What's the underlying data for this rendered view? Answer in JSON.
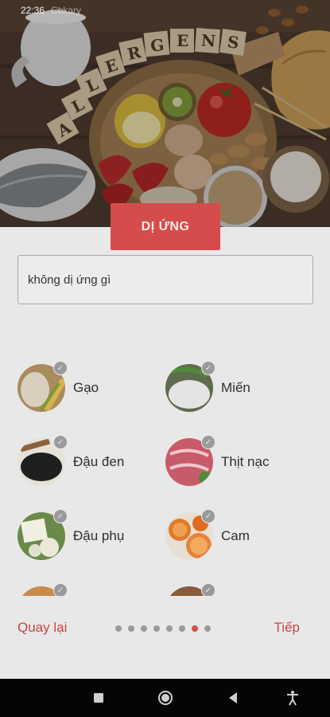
{
  "status_bar": {
    "time": "22:36",
    "carrier": "Cbkary"
  },
  "hero": {
    "sign_text": "ALLERGENS"
  },
  "title_button": "DỊ ỨNG",
  "input": {
    "value": "không dị ứng gì"
  },
  "foods": [
    {
      "label": "Gạo",
      "icon": "rice-icon"
    },
    {
      "label": "Miến",
      "icon": "vermicelli-icon"
    },
    {
      "label": "Đậu đen",
      "icon": "black-bean-icon"
    },
    {
      "label": "Thịt nạc",
      "icon": "lean-meat-icon"
    },
    {
      "label": "Đậu phụ",
      "icon": "tofu-icon"
    },
    {
      "label": "Cam",
      "icon": "orange-icon"
    }
  ],
  "nav": {
    "back_label": "Quay lại",
    "next_label": "Tiếp",
    "page_count": 8,
    "active_page": 7
  },
  "colors": {
    "accent": "#d64c4c",
    "link": "#c84545"
  }
}
